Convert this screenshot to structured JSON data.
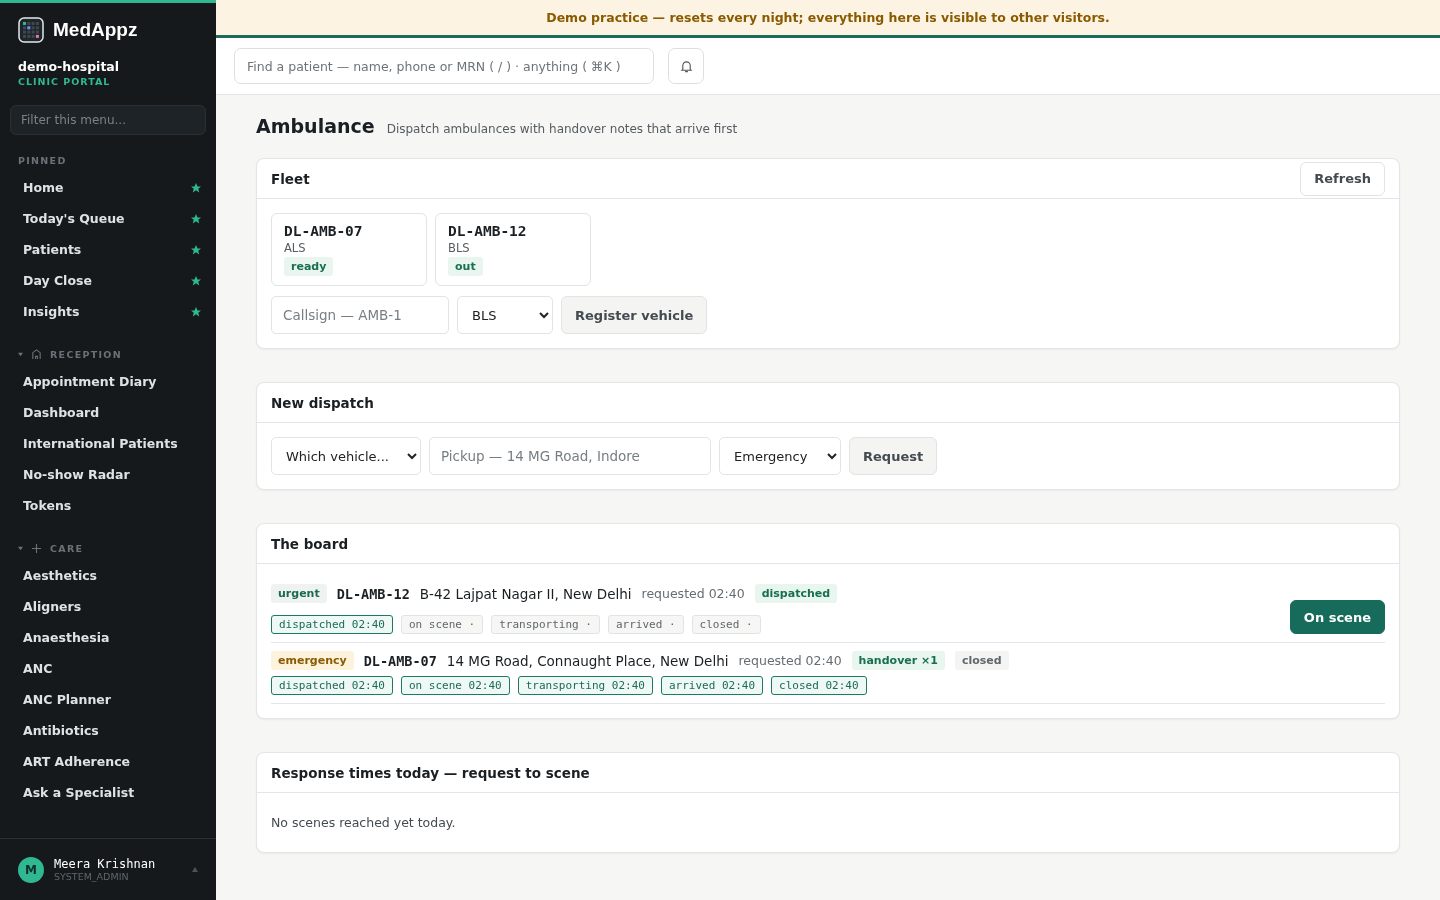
{
  "sidebar": {
    "brand": "MedAppz",
    "org": "demo-hospital",
    "portal": "CLINIC PORTAL",
    "filter_placeholder": "Filter this menu...",
    "pinned_title": "PINNED",
    "pinned": [
      {
        "label": "Home"
      },
      {
        "label": "Today's Queue"
      },
      {
        "label": "Patients"
      },
      {
        "label": "Day Close"
      },
      {
        "label": "Insights"
      }
    ],
    "groups": [
      {
        "title": "RECEPTION",
        "expanded": true,
        "items": [
          "Appointment Diary",
          "Dashboard",
          "International Patients",
          "No-show Radar",
          "Tokens"
        ]
      },
      {
        "title": "CARE",
        "expanded": true,
        "items": [
          "Aesthetics",
          "Aligners",
          "Anaesthesia",
          "ANC",
          "ANC Planner",
          "Antibiotics",
          "ART Adherence",
          "Ask a Specialist"
        ]
      }
    ],
    "user": {
      "initial": "M",
      "name": "Meera Krishnan",
      "role": "SYSTEM_ADMIN"
    }
  },
  "banner": "Demo practice — resets every night; everything here is visible to other visitors.",
  "topbar": {
    "search_placeholder": "Find a patient — name, phone or MRN ( / ) · anything ( ⌘K )"
  },
  "page": {
    "title": "Ambulance",
    "subtitle": "Dispatch ambulances with handover notes that arrive first"
  },
  "fleet": {
    "title": "Fleet",
    "refresh": "Refresh",
    "vehicles": [
      {
        "callsign": "DL-AMB-07",
        "type": "ALS",
        "status": "ready"
      },
      {
        "callsign": "DL-AMB-12",
        "type": "BLS",
        "status": "out"
      }
    ],
    "callsign_placeholder": "Callsign — AMB-1",
    "type_value": "BLS",
    "register": "Register vehicle"
  },
  "dispatch": {
    "title": "New dispatch",
    "vehicle_value": "Which vehicle...",
    "pickup_placeholder": "Pickup — 14 MG Road, Indore",
    "priority_value": "Emergency",
    "request": "Request"
  },
  "board": {
    "title": "The board",
    "rows": [
      {
        "tags_before": [
          {
            "text": "urgent",
            "kind": "muted"
          }
        ],
        "callsign": "DL-AMB-12",
        "address": "B-42 Lajpat Nagar II, New Delhi",
        "requested": "requested 02:40",
        "tags_after": [
          {
            "text": "dispatched",
            "kind": "green"
          }
        ],
        "steps": [
          {
            "label": "dispatched",
            "time": "02:40",
            "done": true
          },
          {
            "label": "on scene",
            "time": "·",
            "done": false
          },
          {
            "label": "transporting",
            "time": "·",
            "done": false
          },
          {
            "label": "arrived",
            "time": "·",
            "done": false
          },
          {
            "label": "closed",
            "time": "·",
            "done": false
          }
        ],
        "action": "On scene"
      },
      {
        "tags_before": [
          {
            "text": "emergency",
            "kind": "amber"
          }
        ],
        "callsign": "DL-AMB-07",
        "address": "14 MG Road, Connaught Place, New Delhi",
        "requested": "requested 02:40",
        "tags_after": [
          {
            "text": "handover ×1",
            "kind": "green"
          },
          {
            "text": "closed",
            "kind": "gray"
          }
        ],
        "steps": [
          {
            "label": "dispatched",
            "time": "02:40",
            "done": true
          },
          {
            "label": "on scene",
            "time": "02:40",
            "done": true
          },
          {
            "label": "transporting",
            "time": "02:40",
            "done": true
          },
          {
            "label": "arrived",
            "time": "02:40",
            "done": true
          },
          {
            "label": "closed",
            "time": "02:40",
            "done": true
          }
        ]
      }
    ]
  },
  "response": {
    "title": "Response times today — request to scene",
    "empty": "No scenes reached yet today."
  }
}
